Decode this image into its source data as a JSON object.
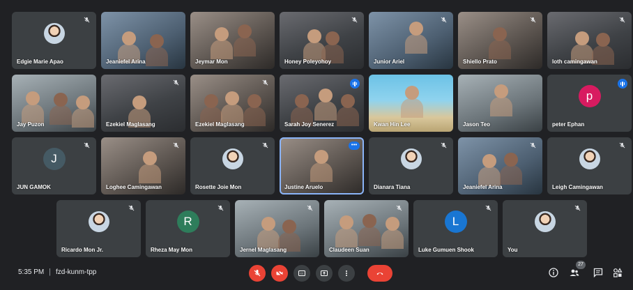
{
  "participants": [
    {
      "name": "Edgie Marie Apao"
    },
    {
      "name": "Jeaniefel Arina"
    },
    {
      "name": "Jeymar Mon"
    },
    {
      "name": "Honey Poleyohoy"
    },
    {
      "name": "Junior Ariel"
    },
    {
      "name": "Shiello Prato"
    },
    {
      "name": "loth camingawan"
    },
    {
      "name": "Jay Puzon"
    },
    {
      "name": "Ezekiel Maglasang"
    },
    {
      "name": "Ezekiel Maglasang"
    },
    {
      "name": "Sarah Joy Senerez"
    },
    {
      "name": "Kwan Hin Lee"
    },
    {
      "name": "Jason Teo"
    },
    {
      "name": "peter Ephan",
      "initial": "p",
      "color": "#d81b60"
    },
    {
      "name": "JUN GAMOK",
      "initial": "J",
      "color": "#455a64"
    },
    {
      "name": "Loghee Camingawan"
    },
    {
      "name": "Rosette Joie Mon"
    },
    {
      "name": "Justine Aruelo"
    },
    {
      "name": "Dianara Tiana"
    },
    {
      "name": "Jeaniefel Arina"
    },
    {
      "name": "Leigh Camingawan"
    },
    {
      "name": "Ricardo Mon Jr."
    },
    {
      "name": "Rheza May Mon",
      "initial": "R",
      "color": "#2e7d5b"
    },
    {
      "name": "Jernel Maglasang"
    },
    {
      "name": "Claudeen Suan"
    },
    {
      "name": "Luke Gumuen Shook",
      "initial": "L",
      "color": "#1976d2"
    },
    {
      "name": "You"
    }
  ],
  "bottom_bar": {
    "time": "5:35 PM",
    "separator": "|",
    "meeting_code": "fzd-kunm-tpp",
    "people_count": "27"
  },
  "colors": {
    "background": "#202124",
    "tile": "#3c4043",
    "red": "#ea4335",
    "accent": "#1a73e8"
  }
}
